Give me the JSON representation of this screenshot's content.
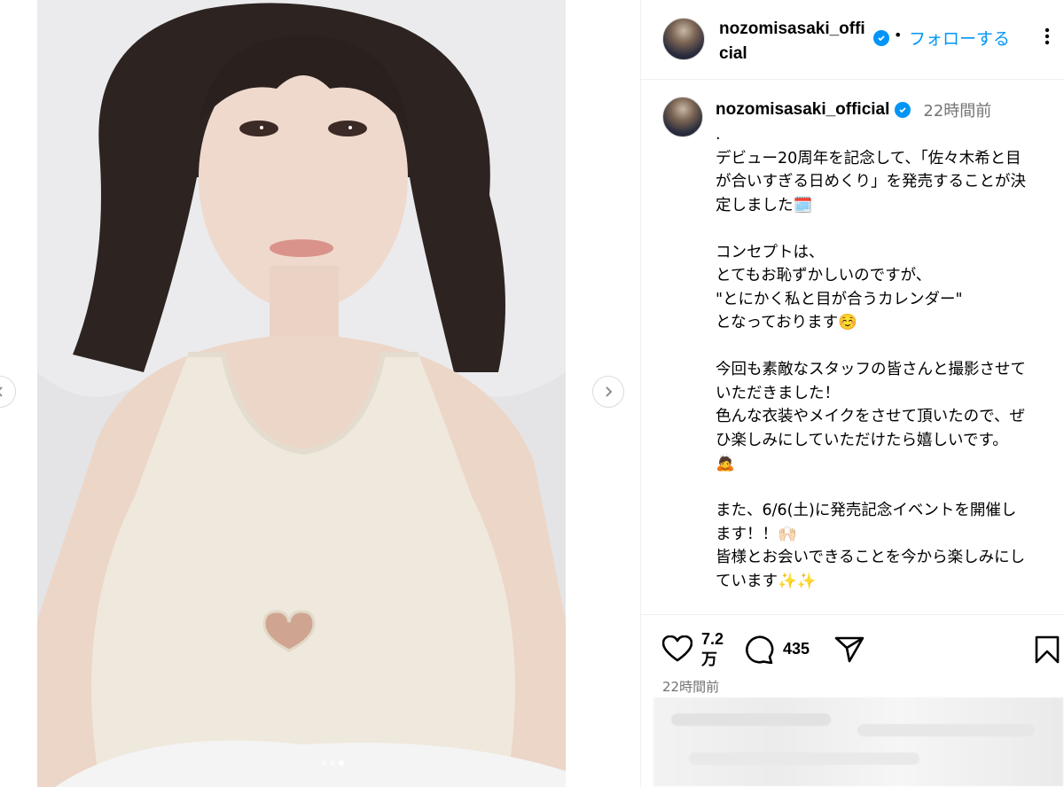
{
  "post": {
    "username": "nozomisasaki_official",
    "username_header": "nozomisasaki_official",
    "follow_label": "フォローする",
    "separator": "•",
    "relative_time": "22時間前",
    "caption": ".\nデビュー20周年を記念して、「佐々木希と目が合いすぎる日めくり」を発売することが決定しました🗓️\n\nコンセプトは、\nとてもお恥ずかしいのですが、\n\"とにかく私と目が合うカレンダー\"\nとなっております☺️\n\n今回も素敵なスタッフの皆さんと撮影させていただきました！\n色んな衣装やメイクをさせて頂いたので、ぜひ楽しみにしていただけたら嬉しいです。🙇\n\nまた、6/6(土)に発売記念イベントを開催します！！🙌🏻\n皆様とお会いできることを今から楽しみにしています✨✨"
  },
  "stats": {
    "likes": "7.2万",
    "comments": "435",
    "timestamp": "22時間前"
  },
  "carousel": {
    "slide_count": 3,
    "active_index": 2
  },
  "icons": {
    "verified": "verified-badge-icon",
    "more": "more-options-icon",
    "like": "heart-icon",
    "comment": "comment-bubble-icon",
    "share": "paper-plane-icon",
    "save": "bookmark-icon",
    "prev": "chevron-left-icon",
    "next": "chevron-right-icon"
  },
  "colors": {
    "accent": "#0095f6",
    "secondary_text": "#737373",
    "border": "#efefef"
  }
}
